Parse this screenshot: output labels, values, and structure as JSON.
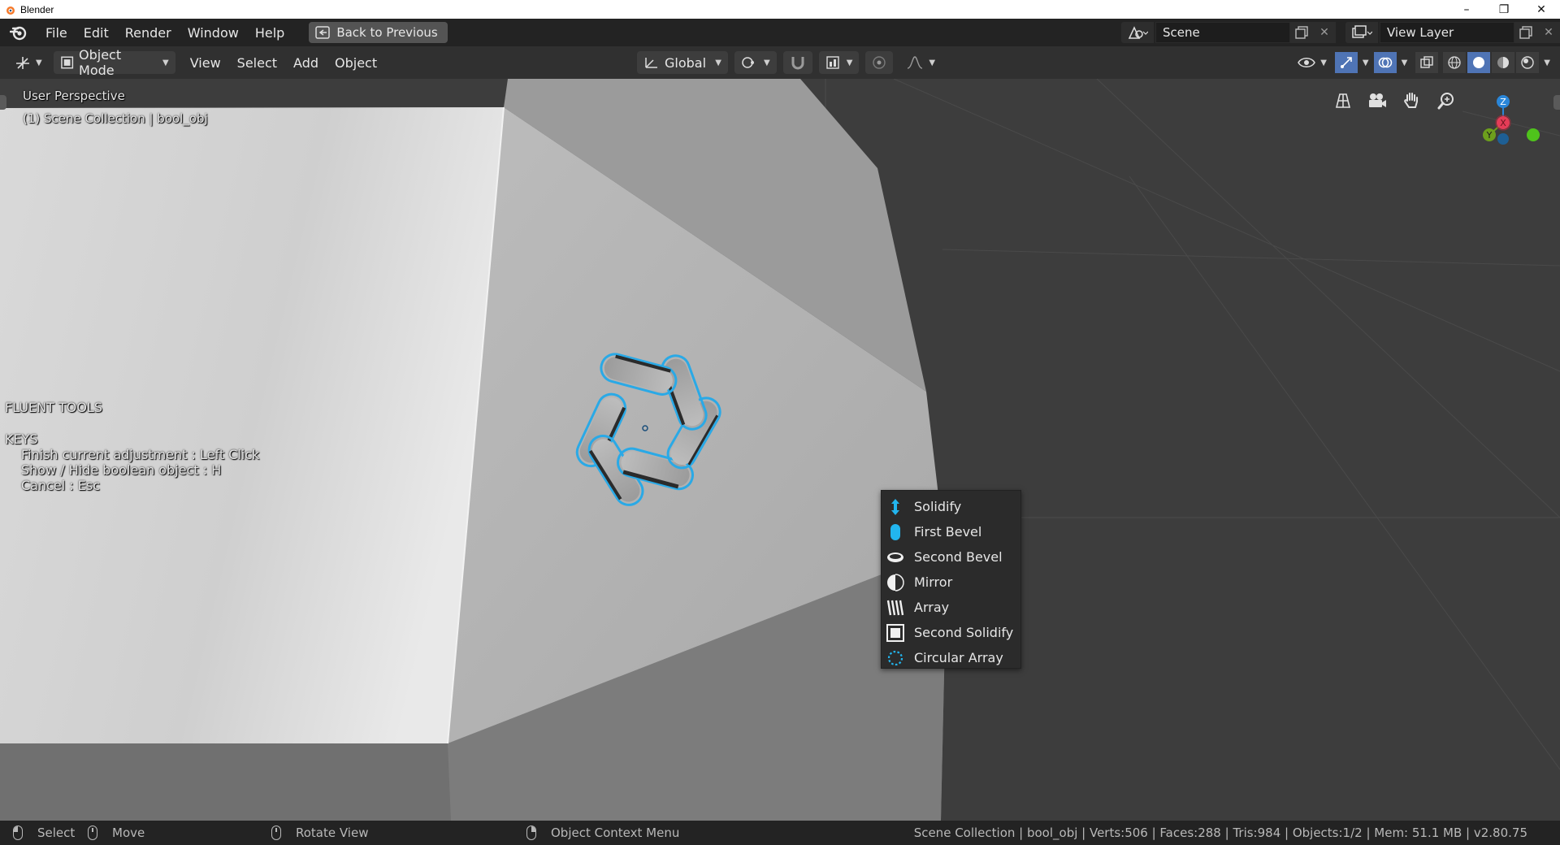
{
  "window": {
    "title": "Blender",
    "minimize": "–",
    "maximize": "❐",
    "close": "✕"
  },
  "topbar": {
    "menus": [
      "File",
      "Edit",
      "Render",
      "Window",
      "Help"
    ],
    "back_button": "Back to Previous",
    "scene_name": "Scene",
    "view_layer": "View Layer"
  },
  "viewport_header": {
    "mode": "Object Mode",
    "menus": [
      "View",
      "Select",
      "Add",
      "Object"
    ],
    "orientation": "Global"
  },
  "viewport": {
    "perspective": "User Perspective",
    "collection": "(1) Scene Collection | bool_obj",
    "gizmo": {
      "z": "Z",
      "y": "Y",
      "x": "X"
    },
    "fluent": {
      "title": "FLUENT TOOLS",
      "keys_heading": "KEYS",
      "line1": "Finish current adjustment : Left Click",
      "line2": "Show / Hide boolean object : H",
      "line3": "Cancel : Esc"
    },
    "highlight_color": "#2aa9e6"
  },
  "popup": {
    "items": [
      {
        "label": "Solidify",
        "icon": "solidify-arrow-icon"
      },
      {
        "label": "First Bevel",
        "icon": "first-bevel-icon"
      },
      {
        "label": "Second Bevel",
        "icon": "second-bevel-icon"
      },
      {
        "label": "Mirror",
        "icon": "mirror-icon"
      },
      {
        "label": "Array",
        "icon": "array-icon"
      },
      {
        "label": "Second Solidify",
        "icon": "second-solidify-icon"
      },
      {
        "label": "Circular Array",
        "icon": "circular-array-icon"
      }
    ]
  },
  "statusbar": {
    "select": "Select",
    "move": "Move",
    "rotate": "Rotate View",
    "context": "Object Context Menu",
    "stats": "Scene Collection | bool_obj | Verts:506 | Faces:288 | Tris:984 | Objects:1/2 | Mem: 51.1 MB | v2.80.75"
  }
}
